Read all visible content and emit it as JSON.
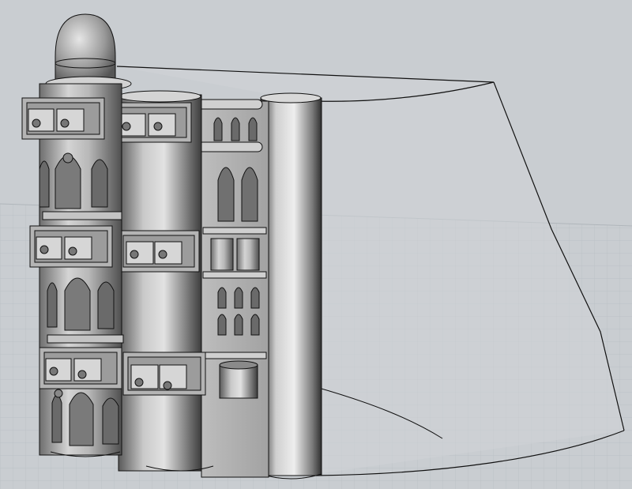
{
  "viewport": {
    "projection": "perspective",
    "display_mode": "shaded",
    "background_color": "#c9cdd1",
    "grid_color": "#b3b9bf",
    "model_color": "#9a9a9a",
    "edge_color": "#000000"
  },
  "scene": {
    "objects": [
      "domed-tower",
      "middle-cylinder-tower",
      "flat-facade-panel",
      "tall-cylinder-column",
      "curved-surface-outline"
    ],
    "tower_levels": 3,
    "window_style": "gothic-arch"
  }
}
